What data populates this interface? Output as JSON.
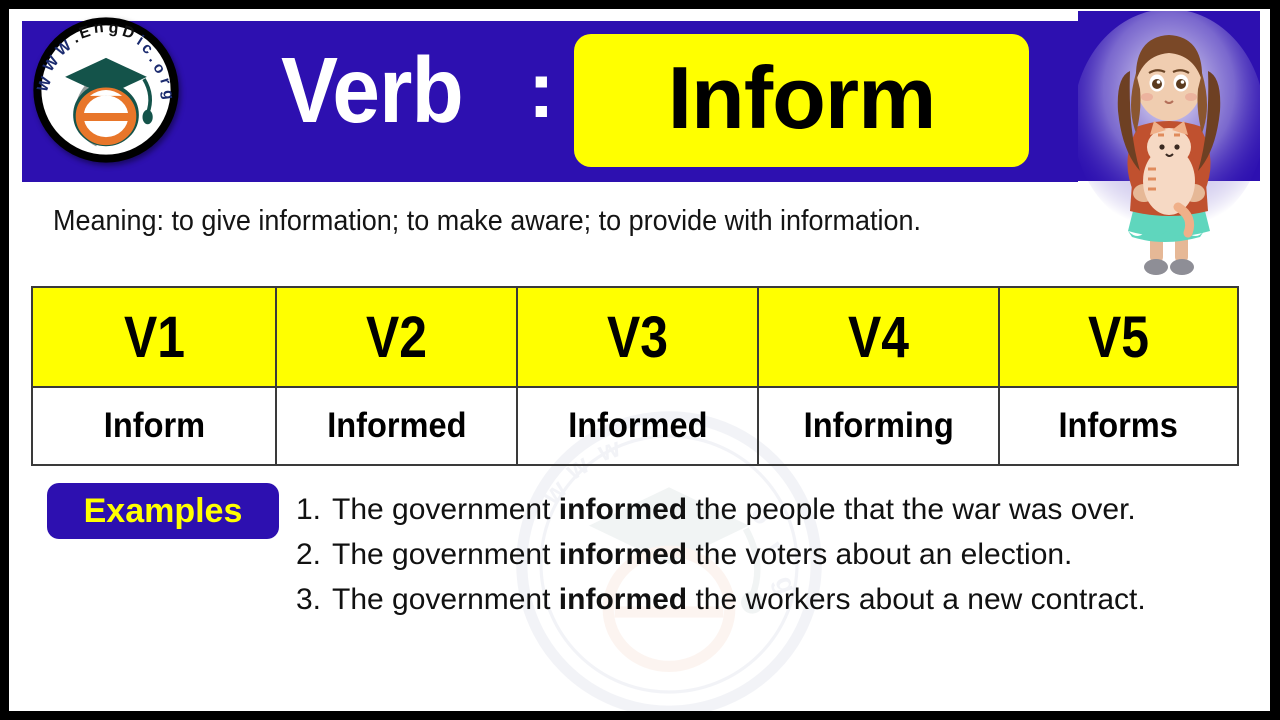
{
  "brand": {
    "logo_text_top": "WWW.",
    "logo_text_mid": "EngDic",
    "logo_text_end": ".org",
    "logo_letter": "e",
    "logo_icon": "graduation-cap-icon",
    "accent_blue": "#2D10B0",
    "accent_yellow": "#FFFF00"
  },
  "header": {
    "part_of_speech": "Verb",
    "separator": ":",
    "word": "Inform",
    "illustration": "girl-holding-cat-illustration"
  },
  "meaning": {
    "text": "Meaning: to give information; to make aware; to provide with information."
  },
  "table": {
    "headers": [
      "V1",
      "V2",
      "V3",
      "V4",
      "V5"
    ],
    "forms": [
      "Inform",
      "Informed",
      "Informed",
      "Informing",
      "Informs"
    ]
  },
  "examples": {
    "badge_label": "Examples",
    "items": [
      {
        "number": "1.",
        "before": "The government ",
        "bold": "informed",
        "after": " the people that the war was over."
      },
      {
        "number": "2.",
        "before": "The government ",
        "bold": "informed",
        "after": " the voters about an election."
      },
      {
        "number": "3.",
        "before": "The government ",
        "bold": "informed",
        "after": " the workers about a new contract."
      }
    ]
  },
  "watermark": {
    "label": "engdic-logo-watermark"
  }
}
